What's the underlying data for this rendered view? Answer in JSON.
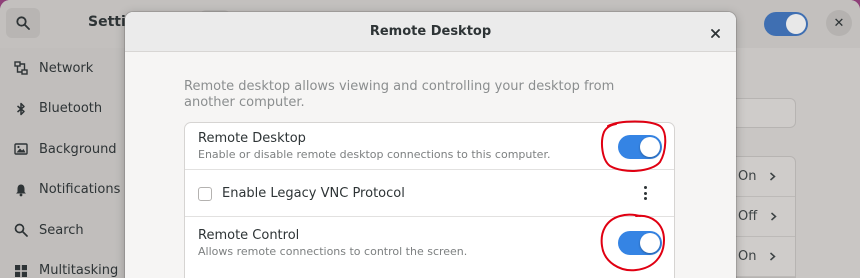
{
  "settings": {
    "title": "Setti",
    "sidebar": {
      "items": [
        {
          "label": "Network",
          "icon": "network-icon"
        },
        {
          "label": "Bluetooth",
          "icon": "bluetooth-icon"
        },
        {
          "label": "Background",
          "icon": "background-icon"
        },
        {
          "label": "Notifications",
          "icon": "bell-icon"
        },
        {
          "label": "Search",
          "icon": "search-icon"
        },
        {
          "label": "Multitasking",
          "icon": "multitasking-icon"
        }
      ]
    },
    "background_rows": [
      {
        "value": "On"
      },
      {
        "value": "Off"
      },
      {
        "value": "On"
      }
    ]
  },
  "dialog": {
    "title": "Remote Desktop",
    "description": "Remote desktop allows viewing and controlling your desktop from another computer.",
    "rows": {
      "remote_desktop": {
        "title": "Remote Desktop",
        "subtitle": "Enable or disable remote desktop connections to this computer.",
        "enabled": true
      },
      "legacy_vnc": {
        "title": "Enable Legacy VNC Protocol",
        "checked": false
      },
      "remote_control": {
        "title": "Remote Control",
        "subtitle": "Allows remote connections to control the screen.",
        "enabled": true
      }
    }
  },
  "colors": {
    "accent": "#3584e4",
    "annotation": "#e00012",
    "wallpaper": "#8e3f78"
  }
}
